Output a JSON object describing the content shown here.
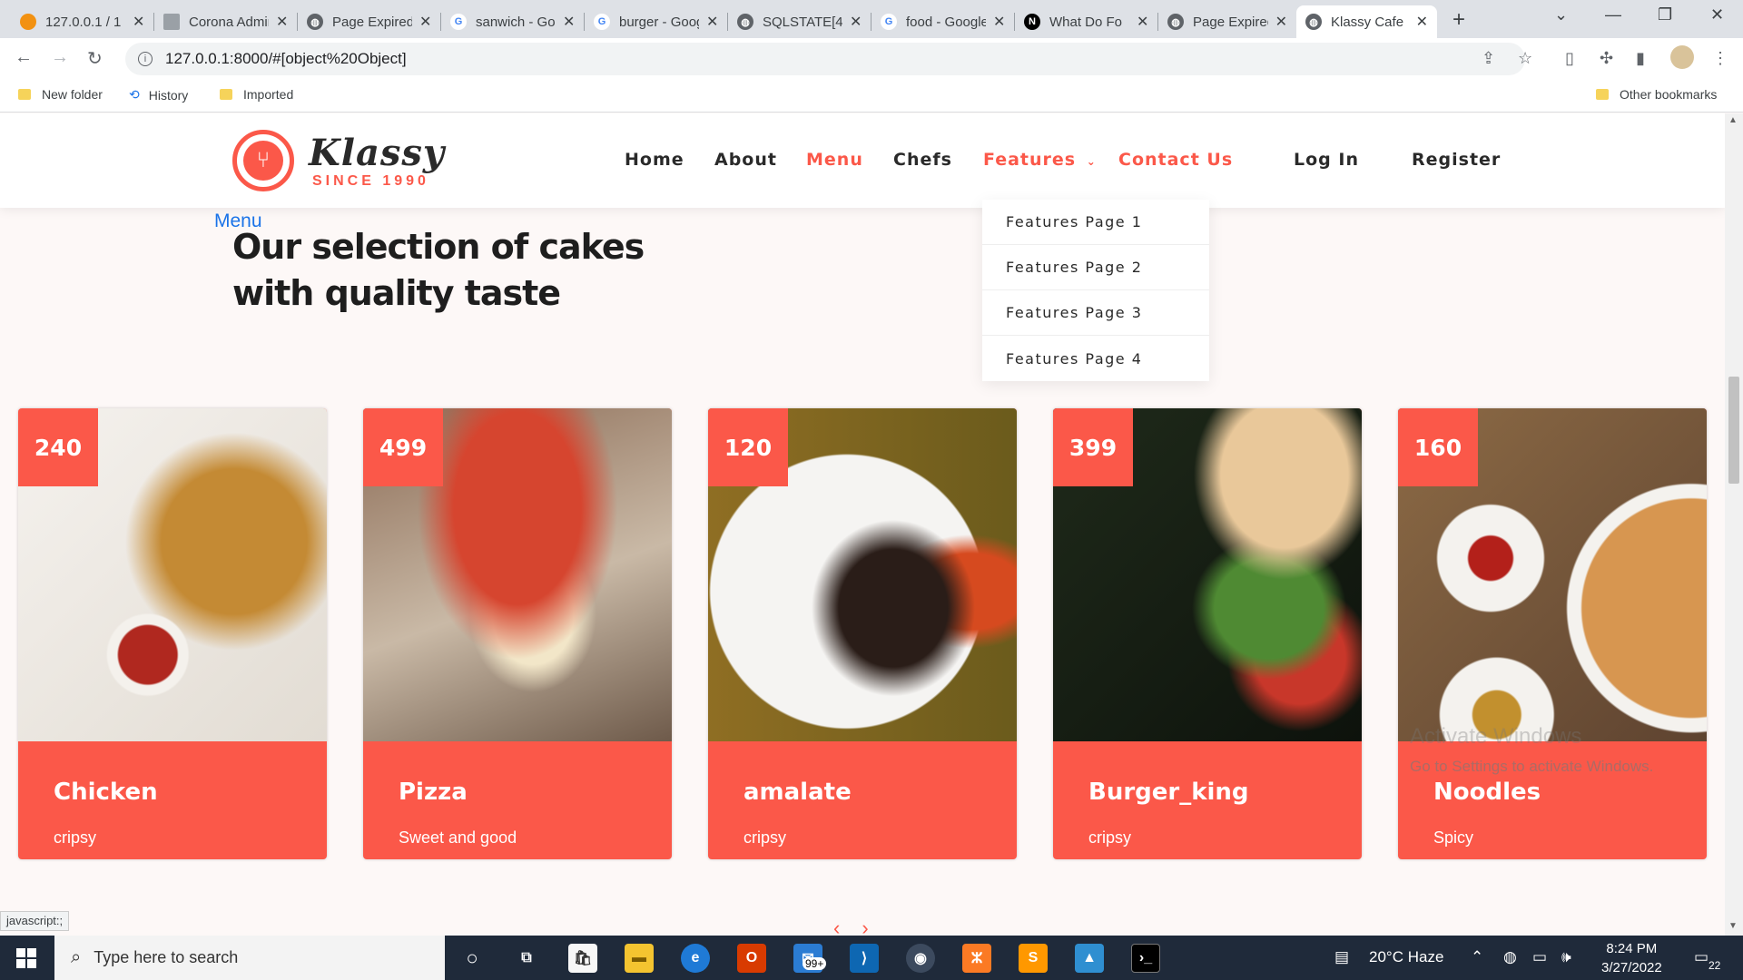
{
  "browser": {
    "tabs": [
      {
        "title": "127.0.0.1 / 1",
        "icon": "phpmyadmin-icon"
      },
      {
        "title": "Corona Admin",
        "icon": "page-icon"
      },
      {
        "title": "Page Expired",
        "icon": "globe-icon"
      },
      {
        "title": "sanwich - Google",
        "icon": "google-icon"
      },
      {
        "title": "burger - Google",
        "icon": "google-icon"
      },
      {
        "title": "SQLSTATE[4",
        "icon": "globe-icon"
      },
      {
        "title": "food - Google",
        "icon": "google-icon"
      },
      {
        "title": "What Do Fo",
        "icon": "notion-icon"
      },
      {
        "title": "Page Expired",
        "icon": "globe-icon"
      },
      {
        "title": "Klassy Cafe",
        "icon": "globe-icon"
      }
    ],
    "url": "127.0.0.1:8000/#[object%20Object]",
    "bookmarks": [
      "New folder",
      "History",
      "Imported"
    ],
    "other_bookmarks": "Other bookmarks",
    "status_url": "javascript:;"
  },
  "site": {
    "logo_text": "Klassy",
    "logo_since": "SINCE 1990",
    "nav": [
      "Home",
      "About",
      "Menu",
      "Chefs",
      "Features",
      "Contact Us",
      "Log In",
      "Register"
    ],
    "features_dropdown": [
      "Features Page 1",
      "Features Page 2",
      "Features Page 3",
      "Features Page 4"
    ],
    "section_kicker": "Menu",
    "section_title_line1": "Our selection of cakes",
    "section_title_line2": "with quality taste",
    "items": [
      {
        "price": "240",
        "name": "Chicken",
        "desc": "cripsy"
      },
      {
        "price": "499",
        "name": "Pizza",
        "desc": "Sweet and good"
      },
      {
        "price": "120",
        "name": "amalate",
        "desc": "cripsy"
      },
      {
        "price": "399",
        "name": "Burger_king",
        "desc": "cripsy"
      },
      {
        "price": "160",
        "name": "Noodles",
        "desc": "Spicy"
      }
    ],
    "accent_color": "#fb5849"
  },
  "windows": {
    "activate_title": "Activate Windows",
    "activate_sub": "Go to Settings to activate Windows.",
    "search_placeholder": "Type here to search",
    "mail_badge": "99+",
    "weather": "20°C Haze",
    "time": "8:24 PM",
    "date": "3/27/2022",
    "notifications": "22"
  }
}
